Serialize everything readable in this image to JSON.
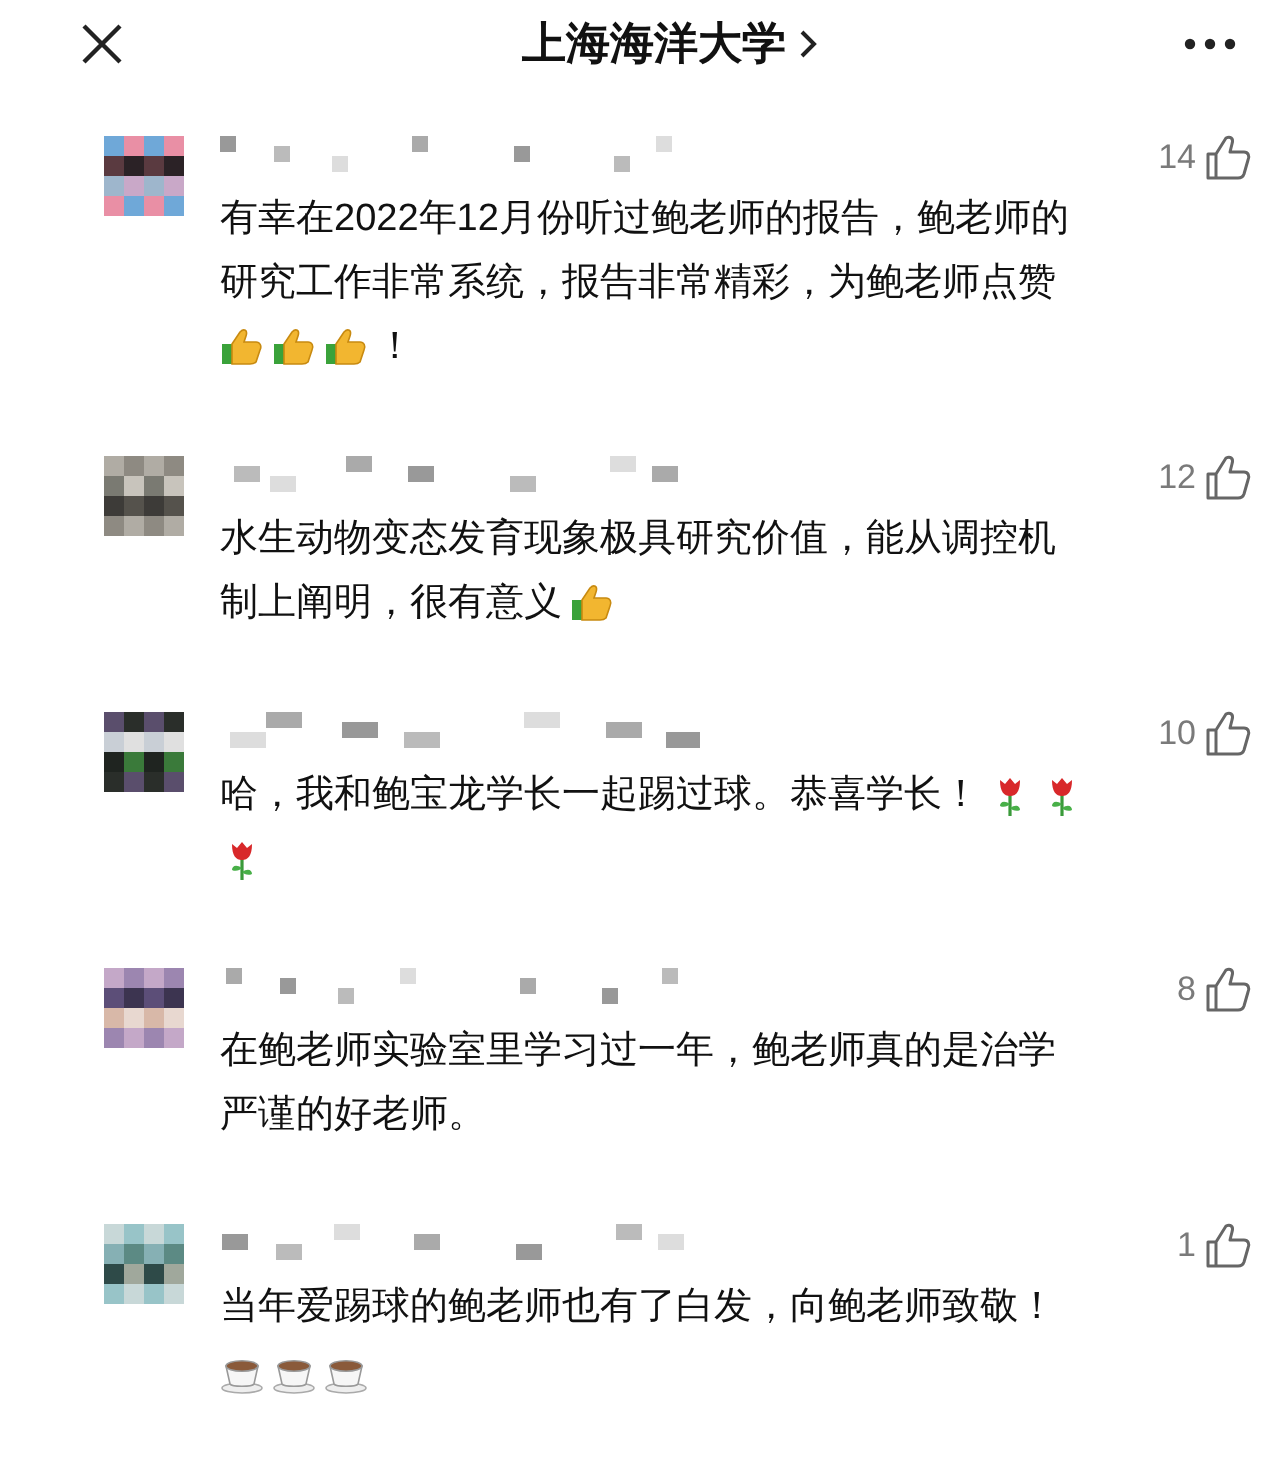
{
  "header": {
    "title": "上海海洋大学"
  },
  "comments": [
    {
      "likes": "14",
      "lines": [
        [
          {
            "kind": "text",
            "text": "有幸在2022年12月份听过鲍老师的报告，鲍老师的"
          }
        ],
        [
          {
            "kind": "text",
            "text": "研究工作非常系统，报告非常精彩，为鲍老师点赞"
          }
        ],
        [
          {
            "kind": "thumbs"
          },
          {
            "kind": "thumbs"
          },
          {
            "kind": "thumbs"
          },
          {
            "kind": "text",
            "text": "！"
          }
        ]
      ]
    },
    {
      "likes": "12",
      "lines": [
        [
          {
            "kind": "text",
            "text": "水生动物变态发育现象极具研究价值，能从调控机"
          }
        ],
        [
          {
            "kind": "text",
            "text": "制上阐明，很有意义"
          },
          {
            "kind": "thumbs"
          }
        ]
      ]
    },
    {
      "likes": "10",
      "lines": [
        [
          {
            "kind": "text",
            "text": "哈，我和鲍宝龙学长一起踢过球。恭喜学长！"
          },
          {
            "kind": "rose"
          },
          {
            "kind": "rose"
          }
        ],
        [
          {
            "kind": "rose"
          }
        ]
      ]
    },
    {
      "likes": "8",
      "lines": [
        [
          {
            "kind": "text",
            "text": "在鲍老师实验室里学习过一年，鲍老师真的是治学"
          }
        ],
        [
          {
            "kind": "text",
            "text": "严谨的好老师。"
          }
        ]
      ]
    },
    {
      "likes": "1",
      "lines": [
        [
          {
            "kind": "text",
            "text": "当年爱踢球的鲍老师也有了白发，向鲍老师致敬！"
          }
        ],
        [
          {
            "kind": "coffee"
          },
          {
            "kind": "coffee"
          },
          {
            "kind": "coffee"
          }
        ]
      ]
    }
  ]
}
